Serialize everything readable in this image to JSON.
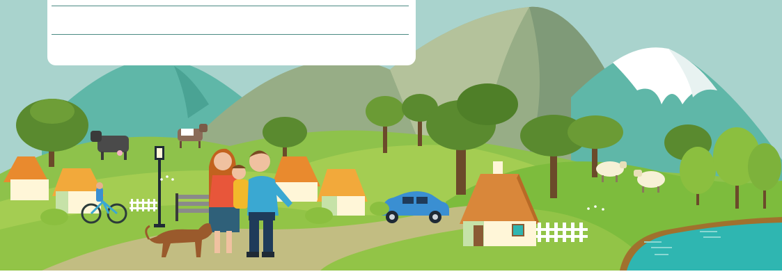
{
  "panel": {
    "line1": "",
    "line2": ""
  },
  "colors": {
    "sky": "#a9d3cd",
    "hill_green": "#7fbf3f",
    "hill_light": "#a8cf52",
    "mountain_teal": "#5fb7a8",
    "mountain_grey": "#8fa88a",
    "snow": "#ffffff",
    "water": "#2fb6b1",
    "path": "#b9b97c",
    "tree_dark": "#5a8a2f",
    "tree_light": "#8bbf3f",
    "roof_orange": "#e98a2e",
    "roof_yellow": "#f2a93b",
    "house_wall": "#fff6d8",
    "car_blue": "#3a8fd2",
    "dog_brown": "#9a5a2c"
  },
  "scene": {
    "icons": [
      "mountain-icon",
      "tree-icon",
      "house-icon",
      "cow-icon",
      "sheep-icon",
      "car-icon",
      "bicycle-icon",
      "dog-icon",
      "family-icon",
      "lamp-post-icon",
      "bench-icon",
      "fence-icon",
      "lake-icon"
    ]
  }
}
